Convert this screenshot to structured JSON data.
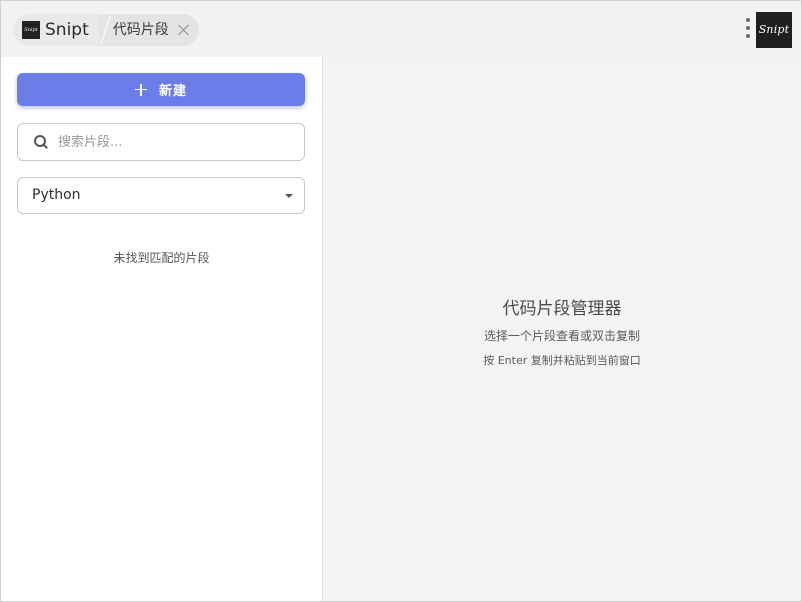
{
  "titlebar": {
    "app_logo_small_text": "Snipt",
    "app_name": "Snipt",
    "tab_label": "代码片段",
    "logo_large_text": "Snipt"
  },
  "sidebar": {
    "new_button_label": "新建",
    "search_placeholder": "搜索片段...",
    "search_value": "",
    "language_selected": "Python",
    "empty_message": "未找到匹配的片段"
  },
  "main": {
    "title": "代码片段管理器",
    "hint_select": "选择一个片段查看或双击复制",
    "hint_enter": "按 Enter 复制并粘贴到当前窗口"
  },
  "icons": {
    "close": "close-icon",
    "more": "more-vertical-icon",
    "plus": "plus-icon",
    "search": "search-icon",
    "dropdown": "chevron-down-icon"
  },
  "colors": {
    "accent": "#6b7de8",
    "logo_bg": "#1f1f1f",
    "main_bg": "#f3f3f3"
  }
}
